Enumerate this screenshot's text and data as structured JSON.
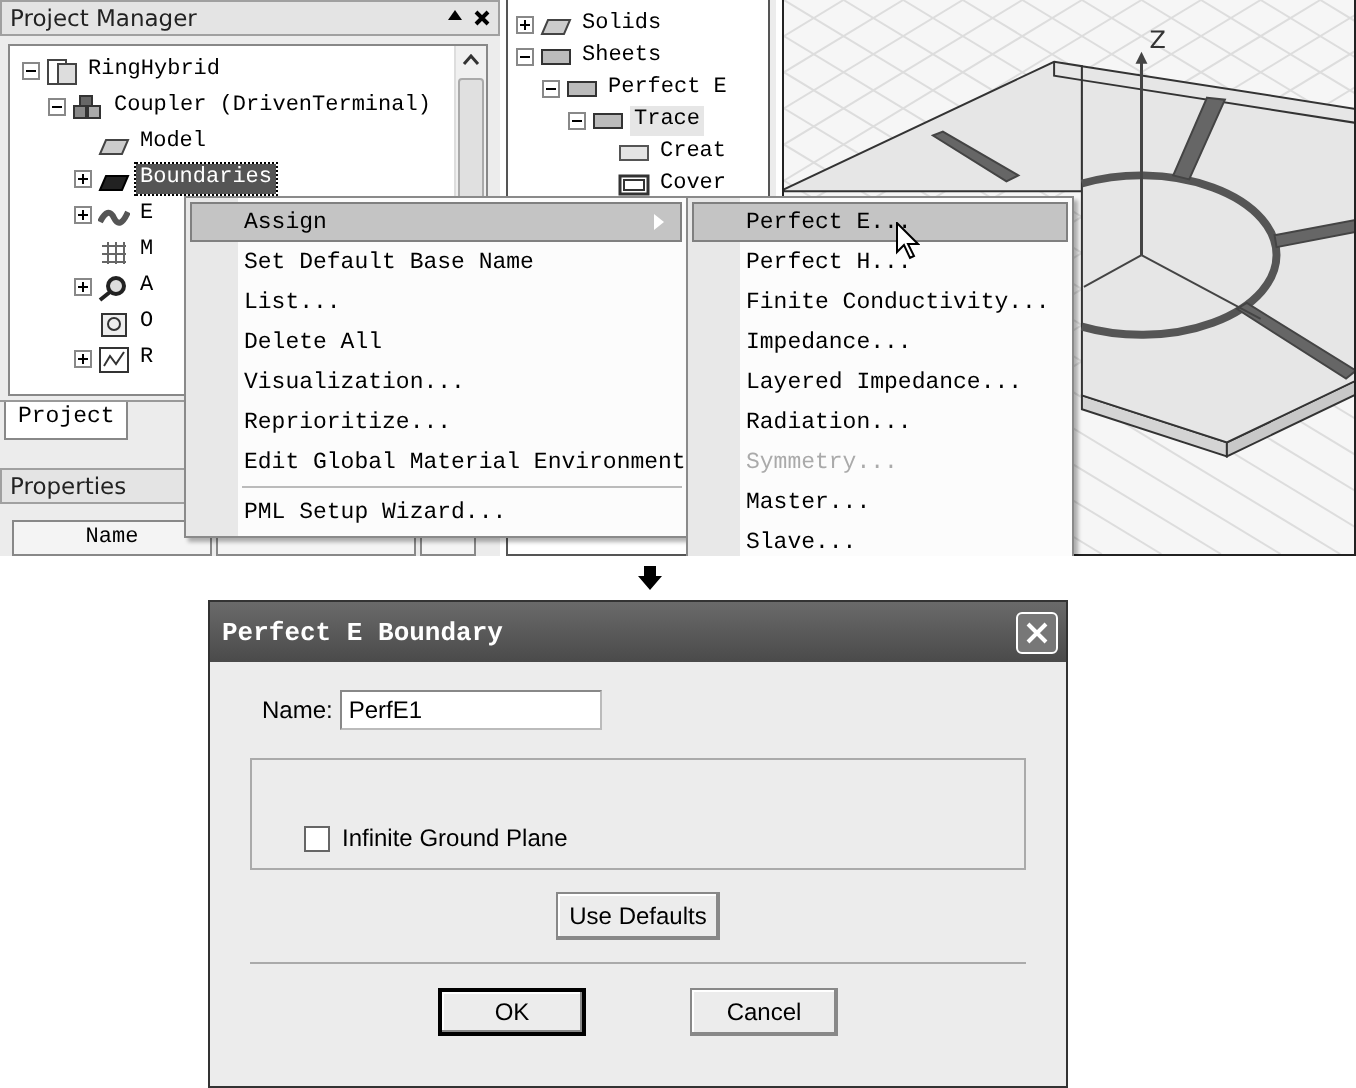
{
  "project_manager": {
    "title": "Project Manager",
    "tree": [
      {
        "label": "RingHybrid",
        "kind": "project",
        "expanded": true,
        "selected": false,
        "children": [
          {
            "label": "Coupler (DrivenTerminal)",
            "kind": "design",
            "expanded": true,
            "selected": false,
            "children": [
              {
                "label": "Model",
                "kind": "model",
                "selected": false
              },
              {
                "label": "Boundaries",
                "kind": "boundaries",
                "expanded": false,
                "selected": true
              },
              {
                "label": "E",
                "kind": "excitations",
                "expanded": false,
                "selected": false
              },
              {
                "label": "M",
                "kind": "mesh",
                "selected": false
              },
              {
                "label": "A",
                "kind": "analysis",
                "expanded": false,
                "selected": false
              },
              {
                "label": "O",
                "kind": "optimetrics",
                "selected": false
              },
              {
                "label": "R",
                "kind": "results",
                "expanded": false,
                "selected": false
              }
            ]
          }
        ]
      }
    ],
    "tab": "Project"
  },
  "properties": {
    "title": "Properties",
    "columns": [
      "Name"
    ]
  },
  "model_tree": [
    {
      "label": "Solids",
      "kind": "solid",
      "expanded": false,
      "selected": false
    },
    {
      "label": "Sheets",
      "kind": "sheet",
      "expanded": true,
      "selected": false,
      "children": [
        {
          "label": "Perfect E",
          "kind": "sheet",
          "expanded": true,
          "selected": false,
          "children": [
            {
              "label": "Trace",
              "kind": "sheet",
              "expanded": true,
              "selected": true,
              "children": [
                {
                  "label": "Creat",
                  "kind": "operation",
                  "selected": false
                },
                {
                  "label": "Cover",
                  "kind": "cover",
                  "selected": false
                }
              ]
            }
          ]
        }
      ]
    }
  ],
  "view": {
    "axis_label": "Z"
  },
  "context_menu": {
    "groups": [
      [
        {
          "label": "Assign",
          "selected": true,
          "submenu": true
        },
        {
          "label": "Set Default Base Name",
          "selected": false
        },
        {
          "label": "List...",
          "selected": false
        },
        {
          "label": "Delete All",
          "selected": false
        },
        {
          "label": "Visualization...",
          "selected": false
        },
        {
          "label": "Reprioritize...",
          "selected": false
        },
        {
          "label": "Edit Global Material Environment",
          "selected": false
        }
      ],
      [
        {
          "label": "PML Setup Wizard...",
          "selected": false
        }
      ]
    ]
  },
  "submenu": {
    "items": [
      {
        "label": "Perfect E...",
        "selected": true,
        "disabled": false
      },
      {
        "label": "Perfect H...",
        "selected": false,
        "disabled": false
      },
      {
        "label": "Finite Conductivity...",
        "selected": false,
        "disabled": false
      },
      {
        "label": "Impedance...",
        "selected": false,
        "disabled": false
      },
      {
        "label": "Layered Impedance...",
        "selected": false,
        "disabled": false
      },
      {
        "label": "Radiation...",
        "selected": false,
        "disabled": false
      },
      {
        "label": "Symmetry...",
        "selected": false,
        "disabled": true
      },
      {
        "label": "Master...",
        "selected": false,
        "disabled": false
      },
      {
        "label": "Slave...",
        "selected": false,
        "disabled": false
      }
    ]
  },
  "dialog": {
    "title": "Perfect E Boundary",
    "name_label": "Name:",
    "name_value": "PerfE1",
    "checkbox": {
      "label": "Infinite Ground Plane",
      "checked": false
    },
    "defaults_button": "Use Defaults",
    "buttons": [
      {
        "label": "OK",
        "default": true
      },
      {
        "label": "Cancel",
        "default": false
      }
    ]
  }
}
